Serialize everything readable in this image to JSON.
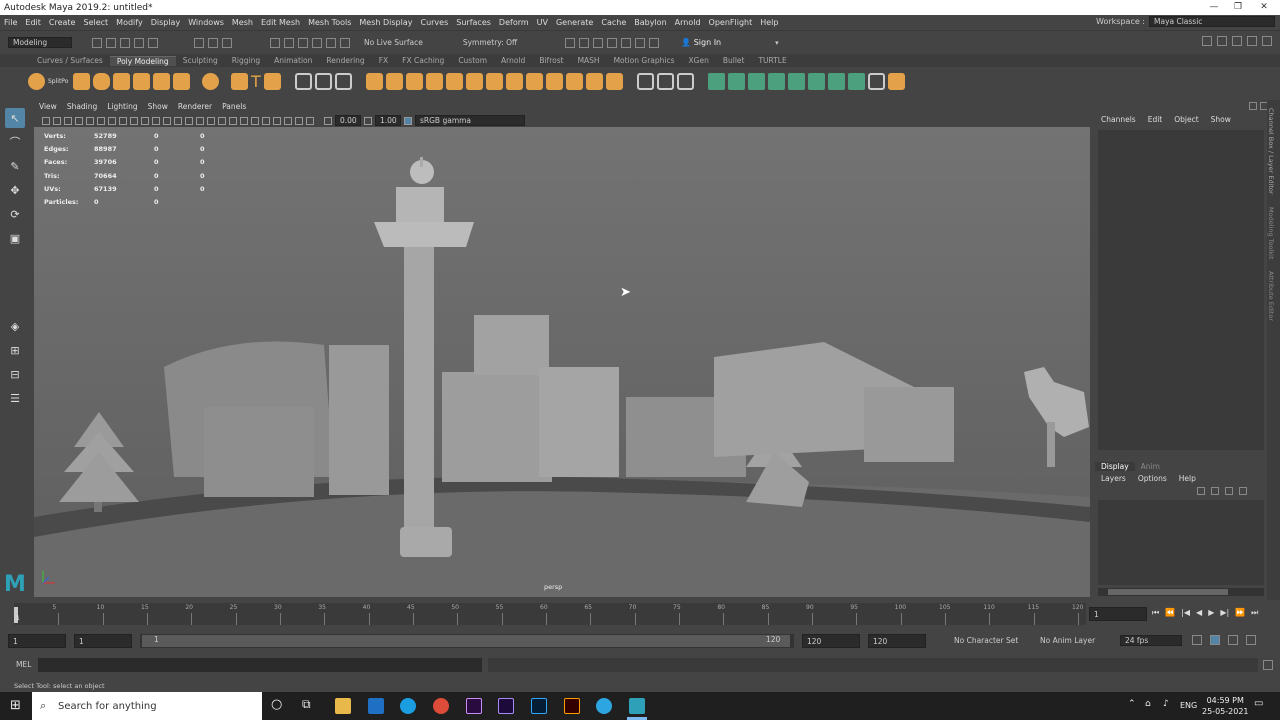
{
  "window": {
    "title": "Autodesk Maya 2019.2: untitled*"
  },
  "menu": [
    "File",
    "Edit",
    "Create",
    "Select",
    "Modify",
    "Display",
    "Windows",
    "Mesh",
    "Edit Mesh",
    "Mesh Tools",
    "Mesh Display",
    "Curves",
    "Surfaces",
    "Deform",
    "UV",
    "Generate",
    "Cache",
    "Babylon",
    "Arnold",
    "OpenFlight",
    "Help"
  ],
  "workspace": {
    "label": "Workspace :",
    "value": "Maya Classic"
  },
  "status": {
    "mode": "Modeling",
    "live": "No Live Surface",
    "symmetry": "Symmetry: Off",
    "signin": "Sign In"
  },
  "shelf_tabs": [
    "Curves / Surfaces",
    "Poly Modeling",
    "Sculpting",
    "Rigging",
    "Animation",
    "Rendering",
    "FX",
    "FX Caching",
    "Custom",
    "Arnold",
    "Bifrost",
    "MASH",
    "Motion Graphics",
    "XGen",
    "Bullet",
    "TURTLE"
  ],
  "shelf_active": "Poly Modeling",
  "shelf_split_label": "SplitPo",
  "viewport_menu": [
    "View",
    "Shading",
    "Lighting",
    "Show",
    "Renderer",
    "Panels"
  ],
  "viewport_toolbar": {
    "exposure": "0.00",
    "gamma": "1.00",
    "colorspace": "sRGB gamma"
  },
  "hud": [
    {
      "k": "Verts:",
      "v": "52789",
      "a": "0",
      "b": "0"
    },
    {
      "k": "Edges:",
      "v": "88987",
      "a": "0",
      "b": "0"
    },
    {
      "k": "Faces:",
      "v": "39706",
      "a": "0",
      "b": "0"
    },
    {
      "k": "Tris:",
      "v": "70664",
      "a": "0",
      "b": "0"
    },
    {
      "k": "UVs:",
      "v": "67139",
      "a": "0",
      "b": "0"
    },
    {
      "k": "Particles:",
      "v": "0",
      "a": "0",
      "b": ""
    }
  ],
  "camera": "persp",
  "channel_tabs": [
    "Channels",
    "Edit",
    "Object",
    "Show"
  ],
  "side_tabs": [
    "Channel Box / Layer Editor",
    "Modeling Toolkit",
    "Attribute Editor"
  ],
  "layer_tabs": [
    "Display",
    "Anim"
  ],
  "layer_menu": [
    "Layers",
    "Options",
    "Help"
  ],
  "timeline": {
    "ticks": [
      "5",
      "10",
      "15",
      "20",
      "25",
      "30",
      "35",
      "40",
      "45",
      "50",
      "55",
      "60",
      "65",
      "70",
      "75",
      "80",
      "85",
      "90",
      "95",
      "100",
      "105",
      "110",
      "115",
      "120"
    ],
    "current_marker": "1",
    "current_frame": "1"
  },
  "range": {
    "start": "1",
    "start2": "1",
    "slider_start": "1",
    "slider_end": "120",
    "end": "120",
    "end2": "120",
    "char_set": "No Character Set",
    "anim_layer": "No Anim Layer",
    "fps": "24 fps"
  },
  "mel": {
    "label": "MEL"
  },
  "help_line": "Select Tool: select an object",
  "taskbar": {
    "search": "Search for anything",
    "lang": "ENG",
    "time": "04:59 PM",
    "date": "25-05-2021"
  }
}
